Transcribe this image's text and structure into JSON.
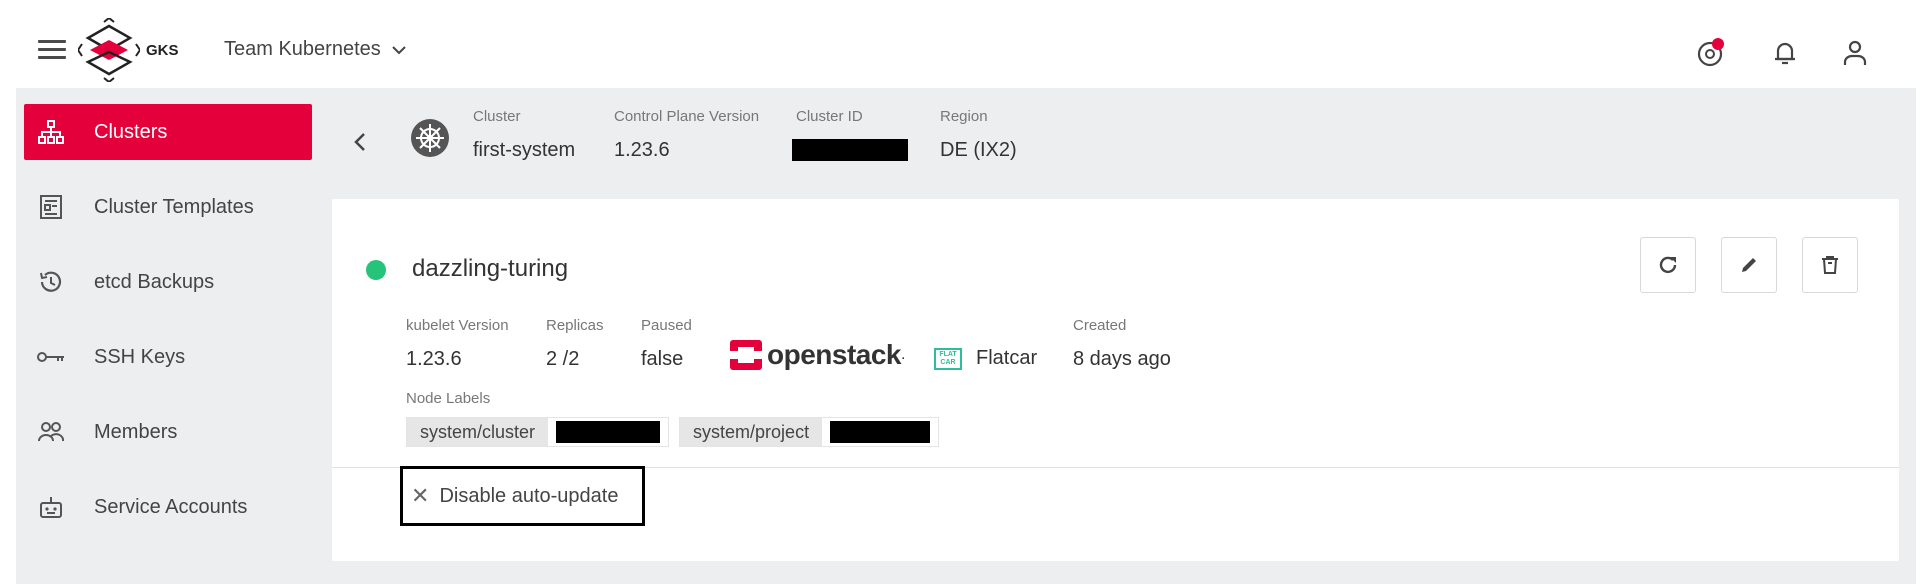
{
  "app": {
    "brand": "GKS",
    "team": "Team Kubernetes"
  },
  "sidebar": {
    "items": [
      {
        "label": "Clusters",
        "icon": "sitemap-icon",
        "active": true
      },
      {
        "label": "Cluster Templates",
        "icon": "template-icon",
        "active": false
      },
      {
        "label": "etcd Backups",
        "icon": "history-icon",
        "active": false
      },
      {
        "label": "SSH Keys",
        "icon": "key-icon",
        "active": false
      },
      {
        "label": "Members",
        "icon": "members-icon",
        "active": false
      },
      {
        "label": "Service Accounts",
        "icon": "robot-icon",
        "active": false
      }
    ]
  },
  "cluster": {
    "name_label": "Cluster",
    "name": "first-system",
    "version_label": "Control Plane Version",
    "version": "1.23.6",
    "id_label": "Cluster ID",
    "region_label": "Region",
    "region": "DE (IX2)"
  },
  "machine_deployment": {
    "name": "dazzling-turing",
    "status_color": "#25c47a",
    "kubelet_label": "kubelet Version",
    "kubelet": "1.23.6",
    "replicas_label": "Replicas",
    "replicas": "2 /2",
    "paused_label": "Paused",
    "paused": "false",
    "provider": "openstack",
    "os_icon_text": "FLAT CAR",
    "os": "Flatcar",
    "created_label": "Created",
    "created": "8 days ago",
    "node_labels_label": "Node Labels",
    "node_labels": [
      {
        "key": "system/cluster"
      },
      {
        "key": "system/project"
      }
    ],
    "auto_update_button": "Disable auto-update"
  },
  "colors": {
    "accent": "#e4003b",
    "status_ok": "#25c47a",
    "content_bg": "#eceef0"
  }
}
